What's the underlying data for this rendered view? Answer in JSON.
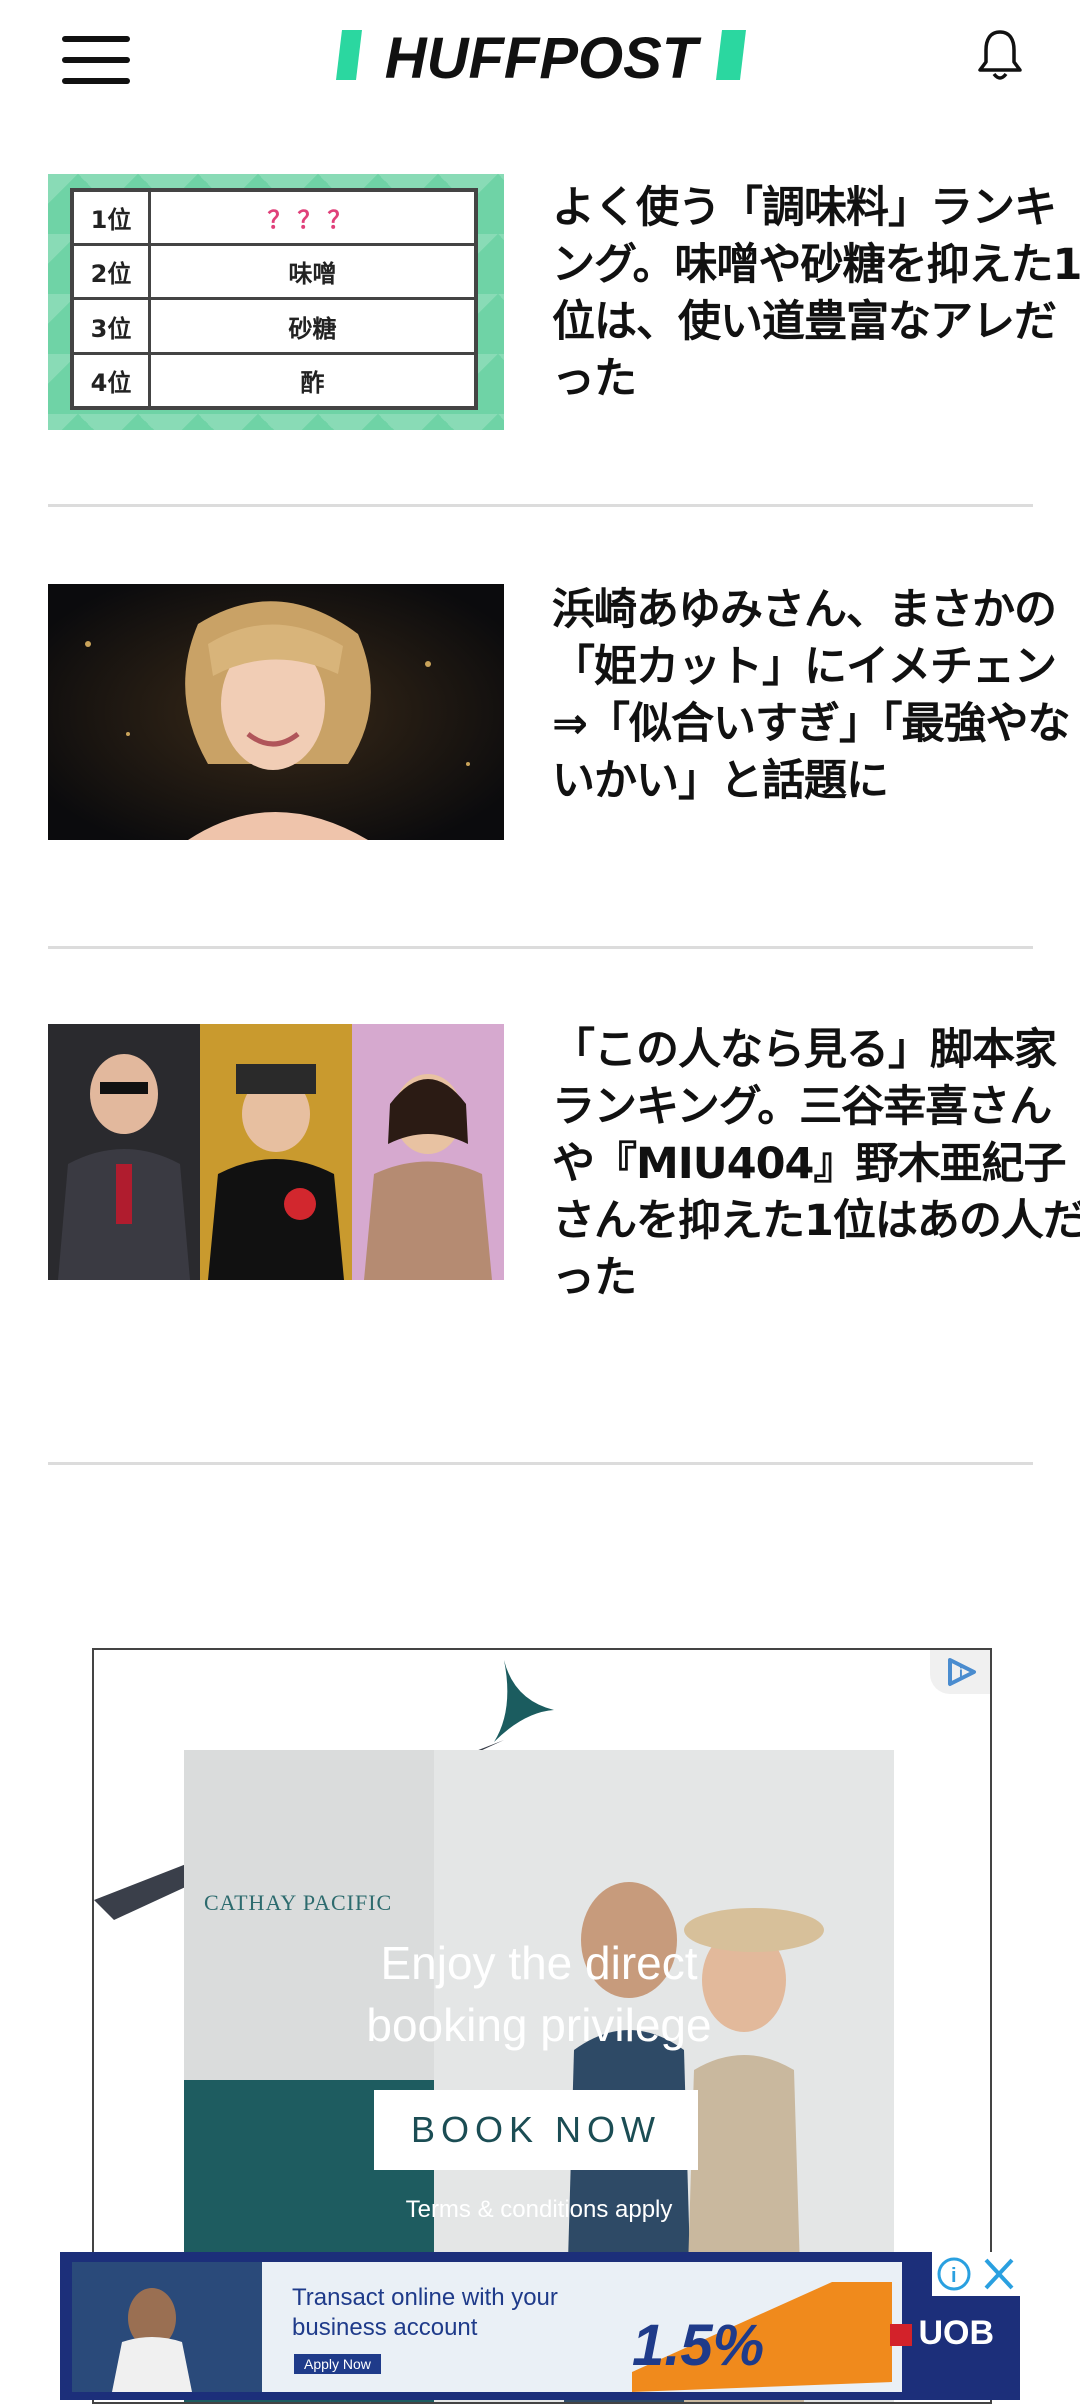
{
  "header": {
    "logo_text": "HUFFPOST",
    "brand_color": "#2bd7a0"
  },
  "articles": [
    {
      "title": "よく使う「調味料」ランキング。味噌や砂糖を抑えた1位は、使い道豊富なアレだった",
      "thumbnail": {
        "type": "ranking-table",
        "rows": [
          {
            "rank": "1位",
            "value": "？？？"
          },
          {
            "rank": "2位",
            "value": "味噌"
          },
          {
            "rank": "3位",
            "value": "砂糖"
          },
          {
            "rank": "4位",
            "value": "酢"
          }
        ]
      }
    },
    {
      "title": "浜崎あゆみさん、まさかの「姫カット」にイメチェン⇒「似合いすぎ」「最強やないかい」と話題に",
      "thumbnail": {
        "type": "photo",
        "icon": "portrait-photo"
      }
    },
    {
      "title": "「この人なら見る」脚本家ランキング。三谷幸喜さんや『MIU404』野木亜紀子さんを抑えた1位はあの人だった",
      "thumbnail": {
        "type": "photo",
        "icon": "three-people-photo"
      }
    }
  ],
  "ad": {
    "brand": "CATHAY PACIFIC",
    "headline_line1": "Enjoy the direct",
    "headline_line2": "booking privilege",
    "cta": "BOOK NOW",
    "terms": "Terms & conditions apply",
    "accent_color": "#1b5c5f"
  },
  "banner": {
    "line1": "Transact online with your",
    "line2": "business account",
    "rate": "1.5%",
    "apply_label": "Apply Now",
    "brand": "UOB",
    "bg_color": "#1c2f7a"
  }
}
